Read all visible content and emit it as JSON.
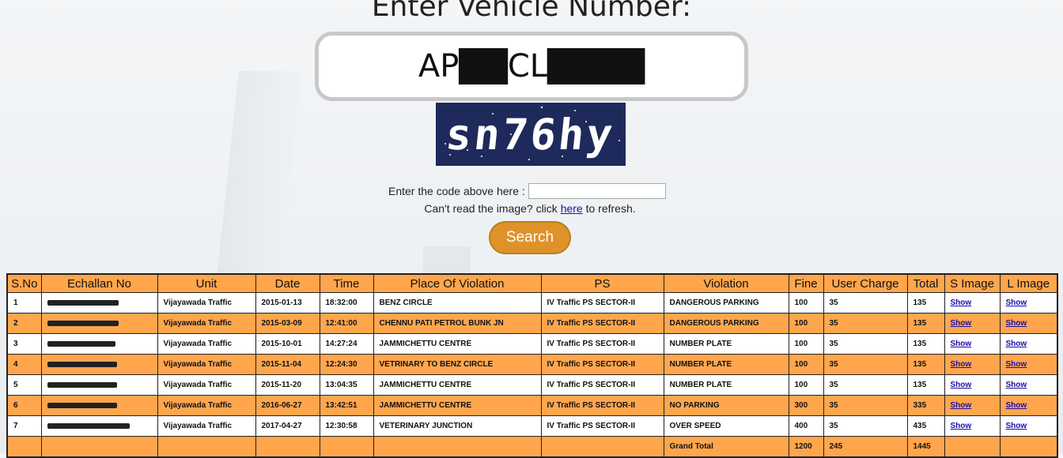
{
  "title": "Enter Vehicle Number:",
  "vehicle_number": "AP██CL████",
  "captcha_text": "sn76hy",
  "code_label": "Enter the code above here :",
  "refresh_prefix": "Can't read the image? click",
  "refresh_link": "here",
  "refresh_suffix": "to refresh.",
  "search_label": "Search",
  "table": {
    "headers": [
      "S.No",
      "Echallan No",
      "Unit",
      "Date",
      "Time",
      "Place Of Violation",
      "PS",
      "Violation",
      "Fine",
      "User Charge",
      "Total",
      "S Image",
      "L Image"
    ],
    "rows": [
      {
        "sno": "1",
        "unit": "Vijayawada Traffic",
        "date": "2015-01-13",
        "time": "18:32:00",
        "place": "BENZ CIRCLE",
        "ps": "IV Traffic PS SECTOR-II",
        "violation": "DANGEROUS PARKING",
        "fine": "100",
        "user_charge": "35",
        "total": "135",
        "s_image": "Show",
        "l_image": "Show"
      },
      {
        "sno": "2",
        "unit": "Vijayawada Traffic",
        "date": "2015-03-09",
        "time": "12:41:00",
        "place": "CHENNU PATI PETROL BUNK JN",
        "ps": "IV Traffic PS SECTOR-II",
        "violation": "DANGEROUS PARKING",
        "fine": "100",
        "user_charge": "35",
        "total": "135",
        "s_image": "Show",
        "l_image": "Show"
      },
      {
        "sno": "3",
        "unit": "Vijayawada Traffic",
        "date": "2015-10-01",
        "time": "14:27:24",
        "place": "JAMMICHETTU CENTRE",
        "ps": "IV Traffic PS SECTOR-II",
        "violation": "NUMBER PLATE",
        "fine": "100",
        "user_charge": "35",
        "total": "135",
        "s_image": "Show",
        "l_image": "Show"
      },
      {
        "sno": "4",
        "unit": "Vijayawada Traffic",
        "date": "2015-11-04",
        "time": "12:24:30",
        "place": "VETRINARY TO BENZ CIRCLE",
        "ps": "IV Traffic PS SECTOR-II",
        "violation": "NUMBER PLATE",
        "fine": "100",
        "user_charge": "35",
        "total": "135",
        "s_image": "Show",
        "l_image": "Show"
      },
      {
        "sno": "5",
        "unit": "Vijayawada Traffic",
        "date": "2015-11-20",
        "time": "13:04:35",
        "place": "JAMMICHETTU CENTRE",
        "ps": "IV Traffic PS SECTOR-II",
        "violation": "NUMBER PLATE",
        "fine": "100",
        "user_charge": "35",
        "total": "135",
        "s_image": "Show",
        "l_image": "Show"
      },
      {
        "sno": "6",
        "unit": "Vijayawada Traffic",
        "date": "2016-06-27",
        "time": "13:42:51",
        "place": "JAMMICHETTU CENTRE",
        "ps": "IV Traffic PS SECTOR-II",
        "violation": "NO PARKING",
        "fine": "300",
        "user_charge": "35",
        "total": "335",
        "s_image": "Show",
        "l_image": "Show"
      },
      {
        "sno": "7",
        "unit": "Vijayawada Traffic",
        "date": "2017-04-27",
        "time": "12:30:58",
        "place": "VETERINARY JUNCTION",
        "ps": "IV Traffic PS SECTOR-II",
        "violation": "OVER SPEED",
        "fine": "400",
        "user_charge": "35",
        "total": "435",
        "s_image": "Show",
        "l_image": "Show"
      }
    ],
    "grand_total": {
      "label": "Grand Total",
      "fine": "1200",
      "user_charge": "245",
      "total": "1445"
    }
  },
  "colors": {
    "header_bg": "#ffa64d",
    "button_bg": "#e0922a",
    "captcha_bg": "#1e2a5c",
    "link": "#1a0dab"
  },
  "icons": [
    "captcha-image"
  ]
}
